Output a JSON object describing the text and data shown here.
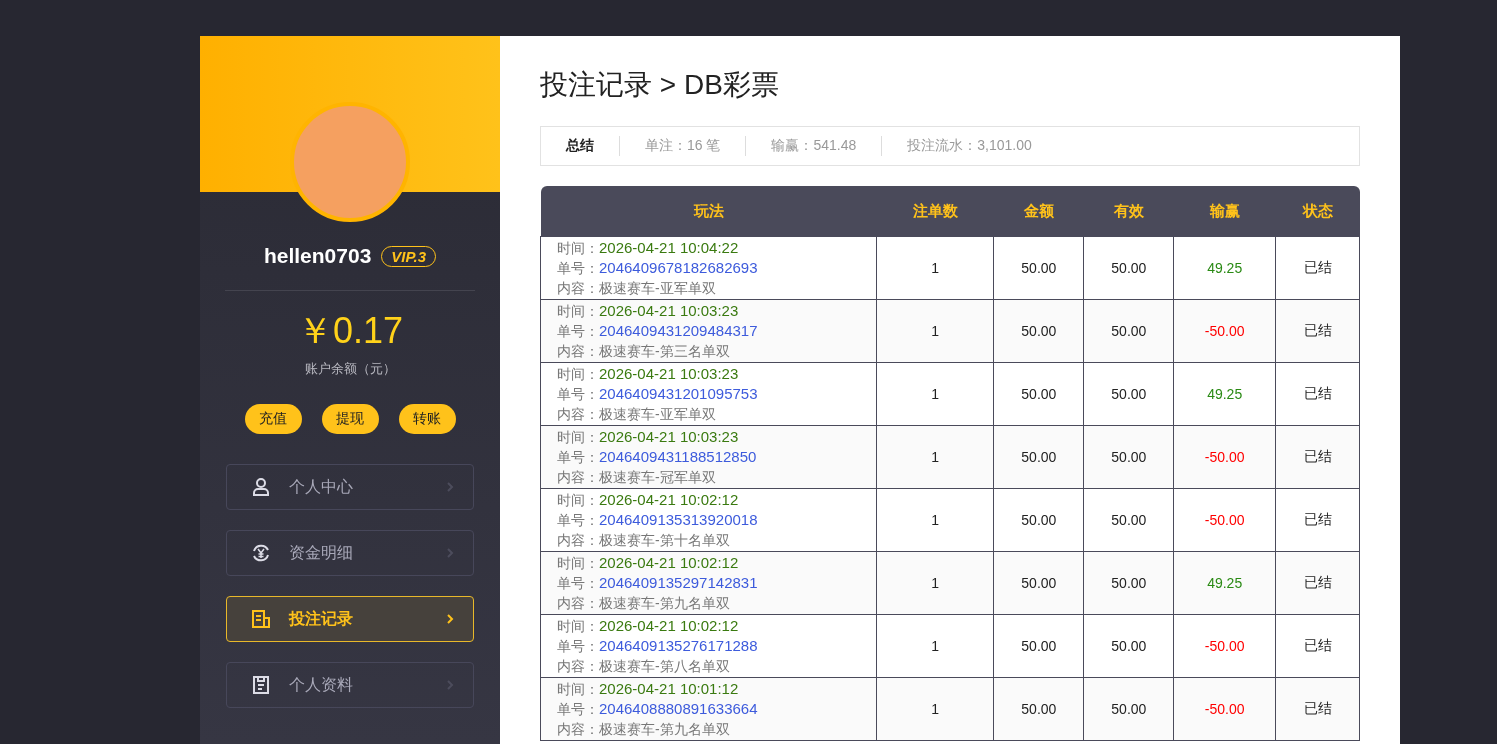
{
  "sidebar": {
    "username": "hellen0703",
    "vip_badge": "VIP.3",
    "balance": "￥0.17",
    "balance_label": "账户余额（元）",
    "actions": [
      "充值",
      "提现",
      "转账"
    ],
    "menu": [
      {
        "label": "个人中心",
        "selected": false
      },
      {
        "label": "资金明细",
        "selected": false
      },
      {
        "label": "投注记录",
        "selected": true
      },
      {
        "label": "个人资料",
        "selected": false
      }
    ]
  },
  "page_title": "投注记录 > DB彩票",
  "summary": [
    {
      "label": "总结",
      "kind": "heading"
    },
    {
      "label": "单注：16 笔",
      "kind": "stat"
    },
    {
      "label": "输赢：541.48",
      "kind": "stat"
    },
    {
      "label": "投注流水：3,101.00",
      "kind": "stat"
    }
  ],
  "table": {
    "columns": [
      "玩法",
      "注单数",
      "金额",
      "有效",
      "输赢",
      "状态"
    ],
    "rows": [
      {
        "time_label": "时间：",
        "time": "2026-04-21 10:04:22",
        "order_label": "单号：",
        "order": "2046409678182682693",
        "content": "内容：极速赛车-亚军单双",
        "count": "1",
        "amount": "50.00",
        "valid": "50.00",
        "result": "49.25",
        "kind": "win",
        "status": "已结"
      },
      {
        "time_label": "时间：",
        "time": "2026-04-21 10:03:23",
        "order_label": "单号：",
        "order": "2046409431209484317",
        "content": "内容：极速赛车-第三名单双",
        "count": "1",
        "amount": "50.00",
        "valid": "50.00",
        "result": "-50.00",
        "kind": "loss",
        "status": "已结"
      },
      {
        "time_label": "时间：",
        "time": "2026-04-21 10:03:23",
        "order_label": "单号：",
        "order": "2046409431201095753",
        "content": "内容：极速赛车-亚军单双",
        "count": "1",
        "amount": "50.00",
        "valid": "50.00",
        "result": "49.25",
        "kind": "win",
        "status": "已结"
      },
      {
        "time_label": "时间：",
        "time": "2026-04-21 10:03:23",
        "order_label": "单号：",
        "order": "2046409431188512850",
        "content": "内容：极速赛车-冠军单双",
        "count": "1",
        "amount": "50.00",
        "valid": "50.00",
        "result": "-50.00",
        "kind": "loss",
        "status": "已结"
      },
      {
        "time_label": "时间：",
        "time": "2026-04-21 10:02:12",
        "order_label": "单号：",
        "order": "2046409135313920018",
        "content": "内容：极速赛车-第十名单双",
        "count": "1",
        "amount": "50.00",
        "valid": "50.00",
        "result": "-50.00",
        "kind": "loss",
        "status": "已结"
      },
      {
        "time_label": "时间：",
        "time": "2026-04-21 10:02:12",
        "order_label": "单号：",
        "order": "2046409135297142831",
        "content": "内容：极速赛车-第九名单双",
        "count": "1",
        "amount": "50.00",
        "valid": "50.00",
        "result": "49.25",
        "kind": "win",
        "status": "已结"
      },
      {
        "time_label": "时间：",
        "time": "2026-04-21 10:02:12",
        "order_label": "单号：",
        "order": "2046409135276171288",
        "content": "内容：极速赛车-第八名单双",
        "count": "1",
        "amount": "50.00",
        "valid": "50.00",
        "result": "-50.00",
        "kind": "loss",
        "status": "已结"
      },
      {
        "time_label": "时间：",
        "time": "2026-04-21 10:01:12",
        "order_label": "单号：",
        "order": "2046408880891633664",
        "content": "内容：极速赛车-第九名单双",
        "count": "1",
        "amount": "50.00",
        "valid": "50.00",
        "result": "-50.00",
        "kind": "loss",
        "status": "已结"
      }
    ]
  }
}
